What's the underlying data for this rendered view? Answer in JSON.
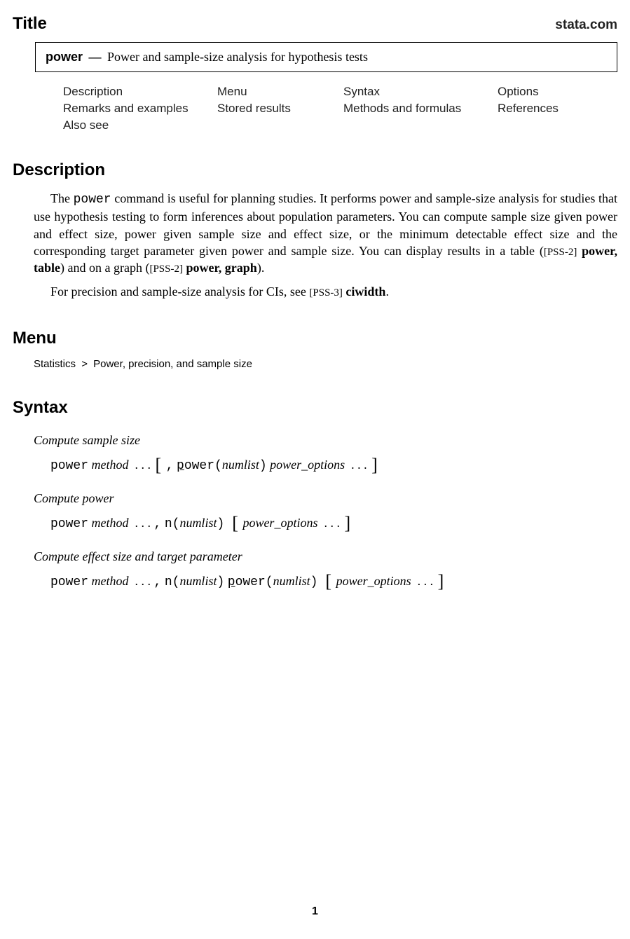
{
  "header": {
    "title": "Title",
    "site": "stata.com"
  },
  "titlebox": {
    "cmd": "power",
    "desc": "Power and sample-size analysis for hypothesis tests"
  },
  "nav": {
    "r1c1": "Description",
    "r1c2": "Menu",
    "r1c3": "Syntax",
    "r1c4": "Options",
    "r2c1": "Remarks and examples",
    "r2c2": "Stored results",
    "r2c3": "Methods and formulas",
    "r2c4": "References",
    "r3c1": "Also see"
  },
  "sections": {
    "description_h": "Description",
    "menu_h": "Menu",
    "syntax_h": "Syntax"
  },
  "description": {
    "p1_a": "The ",
    "p1_cmd": "power",
    "p1_b": " command is useful for planning studies. It performs power and sample-size analysis for studies that use hypothesis testing to form inferences about population parameters. You can compute sample size given power and effect size, power given sample size and effect size, or the minimum detectable effect size and the corresponding target parameter given power and sample size. You can display results in a table (",
    "p1_ref1a": "[PSS-2]",
    "p1_ref1b": " power, table",
    "p1_c": ") and on a graph (",
    "p1_ref2a": "[PSS-2]",
    "p1_ref2b": " power, graph",
    "p1_d": ").",
    "p2_a": "For precision and sample-size analysis for CIs, see ",
    "p2_ref_a": "[PSS-3]",
    "p2_ref_b": " ciwidth",
    "p2_b": "."
  },
  "menu": {
    "a": "Statistics",
    "gt": ">",
    "b": "Power, precision, and sample size"
  },
  "syntax": {
    "sub1": "Compute sample size",
    "sub2": "Compute power",
    "sub3": "Compute effect size and target parameter",
    "tt_power": "power",
    "it_method": "method",
    "dots": ". . .",
    "comma": ",",
    "ul_p": "p",
    "tt_ower": "ower(",
    "it_numlist": "numlist",
    "tt_rparen": ")",
    "it_power_options": "power_options",
    "tt_n": "n(",
    "lbr": "[",
    "rbr": "]"
  },
  "pagenum": "1"
}
